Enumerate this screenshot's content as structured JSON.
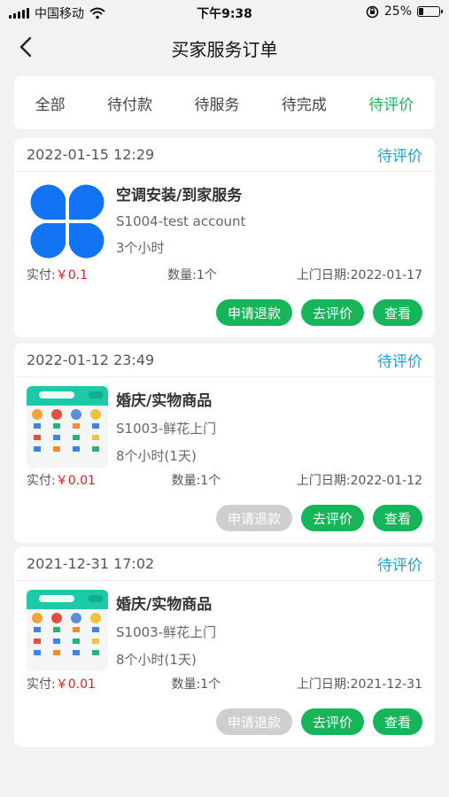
{
  "status_bar": {
    "carrier": "中国移动",
    "time": "下午9:38",
    "battery": "25%",
    "battery_level": 0.25
  },
  "nav": {
    "title": "买家服务订单",
    "back_icon": "chevron-left-icon"
  },
  "tabs": [
    {
      "label": "全部",
      "active": false
    },
    {
      "label": "待付款",
      "active": false
    },
    {
      "label": "待服务",
      "active": false
    },
    {
      "label": "待完成",
      "active": false
    },
    {
      "label": "待评价",
      "active": true
    }
  ],
  "orders": [
    {
      "datetime": "2022-01-15 12:29",
      "status": "待评价",
      "product_name": "空调安装/到家服务",
      "store": "S1004-test account",
      "duration": "3个小时",
      "paid_label": "实付:",
      "price": "￥0.1",
      "qty": "数量:1个",
      "visit_date": "上门日期:2022-01-17",
      "thumb": "clover-logo",
      "buttons": [
        "申请退款",
        "去评价",
        "查看"
      ],
      "refund_disabled": false
    },
    {
      "datetime": "2022-01-12 23:49",
      "status": "待评价",
      "product_name": "婚庆/实物商品",
      "store": "S1003-鲜花上门",
      "duration": "8个小时(1天)",
      "paid_label": "实付:",
      "price": "￥0.01",
      "qty": "数量:1个",
      "visit_date": "上门日期:2022-01-12",
      "thumb": "app-screenshot",
      "buttons": [
        "申请退款",
        "去评价",
        "查看"
      ],
      "refund_disabled": true
    },
    {
      "datetime": "2021-12-31 17:02",
      "status": "待评价",
      "product_name": "婚庆/实物商品",
      "store": "S1003-鲜花上门",
      "duration": "8个小时(1天)",
      "paid_label": "实付:",
      "price": "￥0.01",
      "qty": "数量:1个",
      "visit_date": "上门日期:2021-12-31",
      "thumb": "app-screenshot",
      "buttons": [
        "申请退款",
        "去评价",
        "查看"
      ],
      "refund_disabled": true
    }
  ],
  "colors": {
    "accent": "#16b55a",
    "status": "#1aa0d8",
    "price": "#e02020",
    "disabled": "#cfcfcf"
  }
}
